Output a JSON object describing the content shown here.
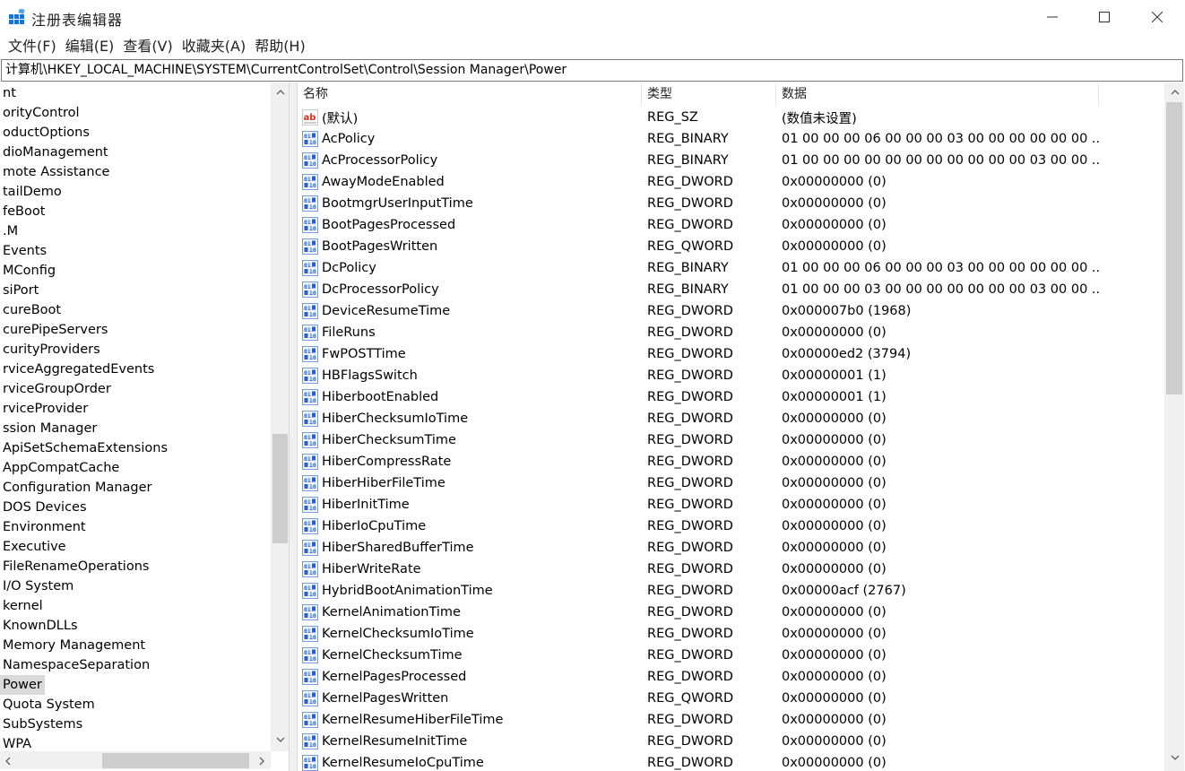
{
  "window": {
    "title": "注册表编辑器",
    "icon": "regedit-icon"
  },
  "menu": [
    "文件(F)",
    "编辑(E)",
    "查看(V)",
    "收藏夹(A)",
    "帮助(H)"
  ],
  "address": "计算机\\HKEY_LOCAL_MACHINE\\SYSTEM\\CurrentControlSet\\Control\\Session Manager\\Power",
  "tree": {
    "items": [
      {
        "label": "nt"
      },
      {
        "label": "orityControl"
      },
      {
        "label": "oductOptions"
      },
      {
        "label": "dioManagement"
      },
      {
        "label": "mote Assistance"
      },
      {
        "label": "tailDemo"
      },
      {
        "label": "feBoot"
      },
      {
        "label": ".M"
      },
      {
        "label": "Events"
      },
      {
        "label": "MConfig"
      },
      {
        "label": "siPort"
      },
      {
        "label": "cureBoot"
      },
      {
        "label": "curePipeServers"
      },
      {
        "label": "curityProviders"
      },
      {
        "label": "rviceAggregatedEvents"
      },
      {
        "label": "rviceGroupOrder"
      },
      {
        "label": "rviceProvider"
      },
      {
        "label": "ssion Manager"
      },
      {
        "label": "ApiSetSchemaExtensions"
      },
      {
        "label": "AppCompatCache"
      },
      {
        "label": "Configuration Manager"
      },
      {
        "label": "DOS Devices"
      },
      {
        "label": "Environment"
      },
      {
        "label": "Executive"
      },
      {
        "label": "FileRenameOperations"
      },
      {
        "label": "I/O System"
      },
      {
        "label": "kernel"
      },
      {
        "label": "KnownDLLs"
      },
      {
        "label": "Memory Management"
      },
      {
        "label": "NamespaceSeparation"
      },
      {
        "label": "Power",
        "selected": true
      },
      {
        "label": "Quota System"
      },
      {
        "label": "SubSystems"
      },
      {
        "label": "WPA"
      }
    ]
  },
  "values": {
    "columns": [
      "名称",
      "类型",
      "数据"
    ],
    "rows": [
      {
        "icon": "string-value-icon",
        "name": "(默认)",
        "type": "REG_SZ",
        "data": "(数值未设置)"
      },
      {
        "icon": "binary-value-icon",
        "name": "AcPolicy",
        "type": "REG_BINARY",
        "data": "01 00 00 00 06 00 00 00 03 00 00 00 00 00 00 ..."
      },
      {
        "icon": "binary-value-icon",
        "name": "AcProcessorPolicy",
        "type": "REG_BINARY",
        "data": "01 00 00 00 00 00 00 00 00 00 00 00 03 00 00 ..."
      },
      {
        "icon": "binary-value-icon",
        "name": "AwayModeEnabled",
        "type": "REG_DWORD",
        "data": "0x00000000 (0)"
      },
      {
        "icon": "binary-value-icon",
        "name": "BootmgrUserInputTime",
        "type": "REG_DWORD",
        "data": "0x00000000 (0)"
      },
      {
        "icon": "binary-value-icon",
        "name": "BootPagesProcessed",
        "type": "REG_DWORD",
        "data": "0x00000000 (0)"
      },
      {
        "icon": "binary-value-icon",
        "name": "BootPagesWritten",
        "type": "REG_QWORD",
        "data": "0x00000000 (0)"
      },
      {
        "icon": "binary-value-icon",
        "name": "DcPolicy",
        "type": "REG_BINARY",
        "data": "01 00 00 00 06 00 00 00 03 00 00 00 00 00 00 ..."
      },
      {
        "icon": "binary-value-icon",
        "name": "DcProcessorPolicy",
        "type": "REG_BINARY",
        "data": "01 00 00 00 03 00 00 00 00 00 00 00 03 00 00 ..."
      },
      {
        "icon": "binary-value-icon",
        "name": "DeviceResumeTime",
        "type": "REG_DWORD",
        "data": "0x000007b0 (1968)"
      },
      {
        "icon": "binary-value-icon",
        "name": "FileRuns",
        "type": "REG_DWORD",
        "data": "0x00000000 (0)"
      },
      {
        "icon": "binary-value-icon",
        "name": "FwPOSTTime",
        "type": "REG_DWORD",
        "data": "0x00000ed2 (3794)"
      },
      {
        "icon": "binary-value-icon",
        "name": "HBFlagsSwitch",
        "type": "REG_DWORD",
        "data": "0x00000001 (1)"
      },
      {
        "icon": "binary-value-icon",
        "name": "HiberbootEnabled",
        "type": "REG_DWORD",
        "data": "0x00000001 (1)"
      },
      {
        "icon": "binary-value-icon",
        "name": "HiberChecksumIoTime",
        "type": "REG_DWORD",
        "data": "0x00000000 (0)"
      },
      {
        "icon": "binary-value-icon",
        "name": "HiberChecksumTime",
        "type": "REG_DWORD",
        "data": "0x00000000 (0)"
      },
      {
        "icon": "binary-value-icon",
        "name": "HiberCompressRate",
        "type": "REG_DWORD",
        "data": "0x00000000 (0)"
      },
      {
        "icon": "binary-value-icon",
        "name": "HiberHiberFileTime",
        "type": "REG_DWORD",
        "data": "0x00000000 (0)"
      },
      {
        "icon": "binary-value-icon",
        "name": "HiberInitTime",
        "type": "REG_DWORD",
        "data": "0x00000000 (0)"
      },
      {
        "icon": "binary-value-icon",
        "name": "HiberIoCpuTime",
        "type": "REG_DWORD",
        "data": "0x00000000 (0)"
      },
      {
        "icon": "binary-value-icon",
        "name": "HiberSharedBufferTime",
        "type": "REG_DWORD",
        "data": "0x00000000 (0)"
      },
      {
        "icon": "binary-value-icon",
        "name": "HiberWriteRate",
        "type": "REG_DWORD",
        "data": "0x00000000 (0)"
      },
      {
        "icon": "binary-value-icon",
        "name": "HybridBootAnimationTime",
        "type": "REG_DWORD",
        "data": "0x00000acf (2767)"
      },
      {
        "icon": "binary-value-icon",
        "name": "KernelAnimationTime",
        "type": "REG_DWORD",
        "data": "0x00000000 (0)"
      },
      {
        "icon": "binary-value-icon",
        "name": "KernelChecksumIoTime",
        "type": "REG_DWORD",
        "data": "0x00000000 (0)"
      },
      {
        "icon": "binary-value-icon",
        "name": "KernelChecksumTime",
        "type": "REG_DWORD",
        "data": "0x00000000 (0)"
      },
      {
        "icon": "binary-value-icon",
        "name": "KernelPagesProcessed",
        "type": "REG_DWORD",
        "data": "0x00000000 (0)"
      },
      {
        "icon": "binary-value-icon",
        "name": "KernelPagesWritten",
        "type": "REG_QWORD",
        "data": "0x00000000 (0)"
      },
      {
        "icon": "binary-value-icon",
        "name": "KernelResumeHiberFileTime",
        "type": "REG_DWORD",
        "data": "0x00000000 (0)"
      },
      {
        "icon": "binary-value-icon",
        "name": "KernelResumeInitTime",
        "type": "REG_DWORD",
        "data": "0x00000000 (0)"
      },
      {
        "icon": "binary-value-icon",
        "name": "KernelResumeIoCpuTime",
        "type": "REG_DWORD",
        "data": "0x00000000 (0)"
      }
    ]
  },
  "colors": {
    "selection": "#d9d9d9",
    "scrollbar_track": "#f0f0f0",
    "scrollbar_thumb": "#cdcdcd",
    "binary_icon_blue": "#2a5ec9",
    "string_icon_red": "#c8331f"
  }
}
